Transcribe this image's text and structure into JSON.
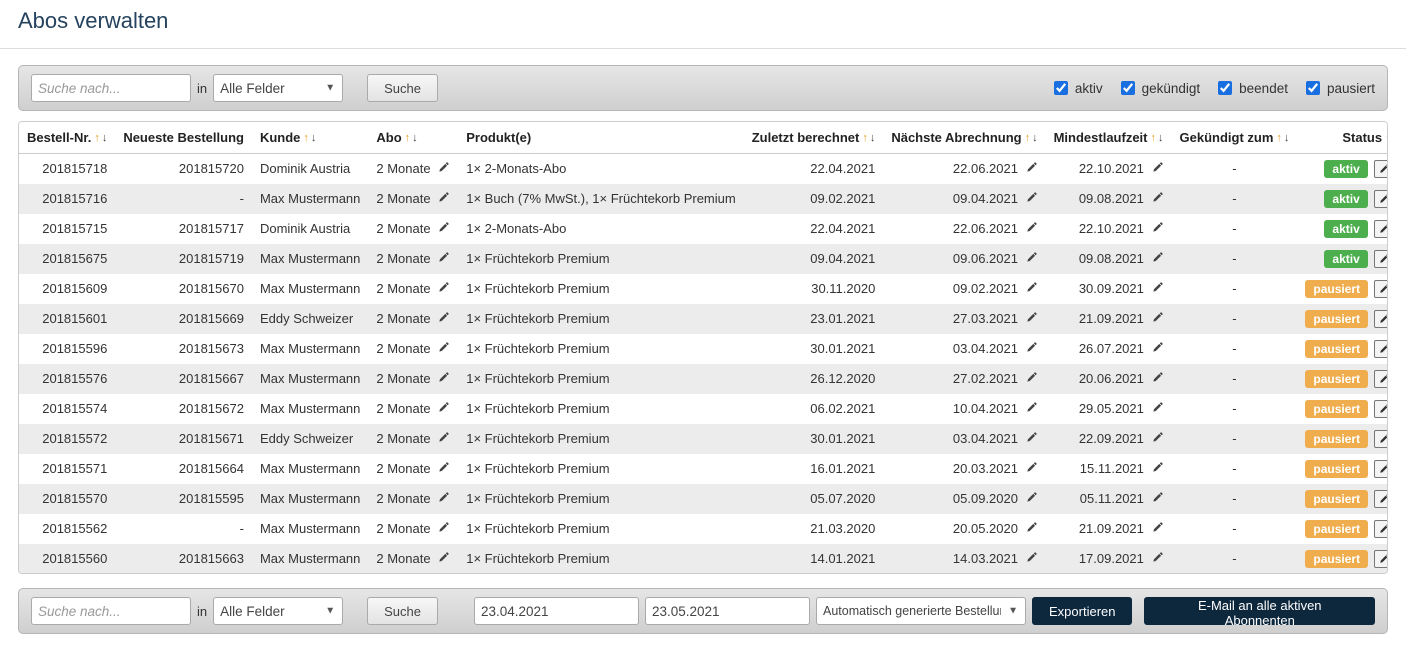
{
  "page": {
    "title": "Abos verwalten"
  },
  "filterTop": {
    "search_placeholder": "Suche nach...",
    "in_label": "in",
    "field_select": "Alle Felder",
    "search_button": "Suche",
    "checkboxes": {
      "aktiv": {
        "label": "aktiv",
        "checked": true
      },
      "gekuendigt": {
        "label": "gekündigt",
        "checked": true
      },
      "beendet": {
        "label": "beendet",
        "checked": true
      },
      "pausiert": {
        "label": "pausiert",
        "checked": true
      }
    }
  },
  "filterBottom": {
    "search_placeholder": "Suche nach...",
    "in_label": "in",
    "field_select": "Alle Felder",
    "search_button": "Suche",
    "date_from": "23.04.2021",
    "date_to": "23.05.2021",
    "auto_orders_select": "Automatisch generierte Bestellungen",
    "export_button": "Exportieren",
    "email_button": "E-Mail an alle aktiven Abonnenten"
  },
  "columns": {
    "bestell": "Bestell-Nr.",
    "neueste": "Neueste Bestellung",
    "kunde": "Kunde",
    "abo": "Abo",
    "produkt": "Produkt(e)",
    "zuletzt": "Zuletzt berechnet",
    "naechste": "Nächste Abrechnung",
    "mindest": "Mindestlaufzeit",
    "gekuendigt": "Gekündigt zum",
    "status": "Status"
  },
  "rows": [
    {
      "bestell": "201815718",
      "neueste": "201815720",
      "kunde": "Dominik Austria",
      "abo": "2 Monate",
      "produkt": "1× 2-Monats-Abo",
      "zuletzt": "22.04.2021",
      "naechste": "22.06.2021",
      "mindest": "22.10.2021",
      "gekuendigt": "-",
      "status": "aktiv"
    },
    {
      "bestell": "201815716",
      "neueste": "-",
      "kunde": "Max Mustermann",
      "abo": "2 Monate",
      "produkt": "1× Buch (7% MwSt.), 1× Früchtekorb Premium",
      "zuletzt": "09.02.2021",
      "naechste": "09.04.2021",
      "mindest": "09.08.2021",
      "gekuendigt": "-",
      "status": "aktiv"
    },
    {
      "bestell": "201815715",
      "neueste": "201815717",
      "kunde": "Dominik Austria",
      "abo": "2 Monate",
      "produkt": "1× 2-Monats-Abo",
      "zuletzt": "22.04.2021",
      "naechste": "22.06.2021",
      "mindest": "22.10.2021",
      "gekuendigt": "-",
      "status": "aktiv"
    },
    {
      "bestell": "201815675",
      "neueste": "201815719",
      "kunde": "Max Mustermann",
      "abo": "2 Monate",
      "produkt": "1× Früchtekorb Premium",
      "zuletzt": "09.04.2021",
      "naechste": "09.06.2021",
      "mindest": "09.08.2021",
      "gekuendigt": "-",
      "status": "aktiv"
    },
    {
      "bestell": "201815609",
      "neueste": "201815670",
      "kunde": "Max Mustermann",
      "abo": "2 Monate",
      "produkt": "1× Früchtekorb Premium",
      "zuletzt": "30.11.2020",
      "naechste": "09.02.2021",
      "mindest": "30.09.2021",
      "gekuendigt": "-",
      "status": "pausiert"
    },
    {
      "bestell": "201815601",
      "neueste": "201815669",
      "kunde": "Eddy Schweizer",
      "abo": "2 Monate",
      "produkt": "1× Früchtekorb Premium",
      "zuletzt": "23.01.2021",
      "naechste": "27.03.2021",
      "mindest": "21.09.2021",
      "gekuendigt": "-",
      "status": "pausiert"
    },
    {
      "bestell": "201815596",
      "neueste": "201815673",
      "kunde": "Max Mustermann",
      "abo": "2 Monate",
      "produkt": "1× Früchtekorb Premium",
      "zuletzt": "30.01.2021",
      "naechste": "03.04.2021",
      "mindest": "26.07.2021",
      "gekuendigt": "-",
      "status": "pausiert"
    },
    {
      "bestell": "201815576",
      "neueste": "201815667",
      "kunde": "Max Mustermann",
      "abo": "2 Monate",
      "produkt": "1× Früchtekorb Premium",
      "zuletzt": "26.12.2020",
      "naechste": "27.02.2021",
      "mindest": "20.06.2021",
      "gekuendigt": "-",
      "status": "pausiert"
    },
    {
      "bestell": "201815574",
      "neueste": "201815672",
      "kunde": "Max Mustermann",
      "abo": "2 Monate",
      "produkt": "1× Früchtekorb Premium",
      "zuletzt": "06.02.2021",
      "naechste": "10.04.2021",
      "mindest": "29.05.2021",
      "gekuendigt": "-",
      "status": "pausiert"
    },
    {
      "bestell": "201815572",
      "neueste": "201815671",
      "kunde": "Eddy Schweizer",
      "abo": "2 Monate",
      "produkt": "1× Früchtekorb Premium",
      "zuletzt": "30.01.2021",
      "naechste": "03.04.2021",
      "mindest": "22.09.2021",
      "gekuendigt": "-",
      "status": "pausiert"
    },
    {
      "bestell": "201815571",
      "neueste": "201815664",
      "kunde": "Max Mustermann",
      "abo": "2 Monate",
      "produkt": "1× Früchtekorb Premium",
      "zuletzt": "16.01.2021",
      "naechste": "20.03.2021",
      "mindest": "15.11.2021",
      "gekuendigt": "-",
      "status": "pausiert"
    },
    {
      "bestell": "201815570",
      "neueste": "201815595",
      "kunde": "Max Mustermann",
      "abo": "2 Monate",
      "produkt": "1× Früchtekorb Premium",
      "zuletzt": "05.07.2020",
      "naechste": "05.09.2020",
      "mindest": "05.11.2021",
      "gekuendigt": "-",
      "status": "pausiert"
    },
    {
      "bestell": "201815562",
      "neueste": "-",
      "kunde": "Max Mustermann",
      "abo": "2 Monate",
      "produkt": "1× Früchtekorb Premium",
      "zuletzt": "21.03.2020",
      "naechste": "20.05.2020",
      "mindest": "21.09.2021",
      "gekuendigt": "-",
      "status": "pausiert"
    },
    {
      "bestell": "201815560",
      "neueste": "201815663",
      "kunde": "Max Mustermann",
      "abo": "2 Monate",
      "produkt": "1× Früchtekorb Premium",
      "zuletzt": "14.01.2021",
      "naechste": "14.03.2021",
      "mindest": "17.09.2021",
      "gekuendigt": "-",
      "status": "pausiert"
    }
  ]
}
